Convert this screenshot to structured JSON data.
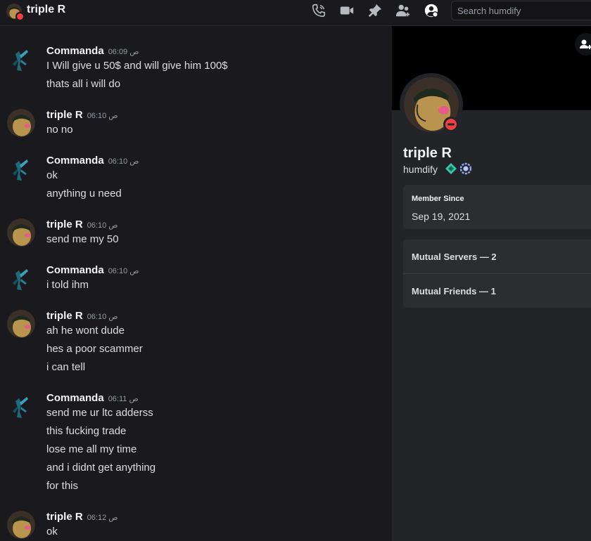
{
  "header": {
    "title": "triple R",
    "search_placeholder": "Search humdify",
    "icons": [
      "phone-call-icon",
      "video-call-icon",
      "pin-icon",
      "add-friend-icon",
      "user-profile-icon"
    ]
  },
  "messages": [
    {
      "author": "Commanda",
      "time": "ص 06:09",
      "lines": [
        "I Will give u 50$ and will give him 100$",
        "thats all i will do"
      ]
    },
    {
      "author": "triple R",
      "time": "ص 06:10",
      "lines": [
        "no no"
      ]
    },
    {
      "author": "Commanda",
      "time": "ص 06:10",
      "lines": [
        "ok",
        "anything u need"
      ]
    },
    {
      "author": "triple R",
      "time": "ص 06:10",
      "lines": [
        "send me my 50"
      ]
    },
    {
      "author": "Commanda",
      "time": "ص 06:10",
      "lines": [
        "i told ihm"
      ]
    },
    {
      "author": "triple R",
      "time": "ص 06:10",
      "lines": [
        "ah he wont dude",
        "hes a poor scammer",
        "i can tell"
      ]
    },
    {
      "author": "Commanda",
      "time": "ص 06:11",
      "lines": [
        "send me ur ltc adderss",
        "this fucking trade",
        "lose me all my time",
        "and i didnt get anything",
        "for this"
      ]
    },
    {
      "author": "triple R",
      "time": "ص 06:12",
      "lines": [
        "ok"
      ]
    }
  ],
  "profile": {
    "name": "triple R",
    "handle": "humdify",
    "member_since_label": "Member Since",
    "member_since": "Sep 19, 2021",
    "mutual_servers": "Mutual Servers — 2",
    "mutual_friends": "Mutual Friends — 1",
    "status_color": "#f23f43"
  }
}
